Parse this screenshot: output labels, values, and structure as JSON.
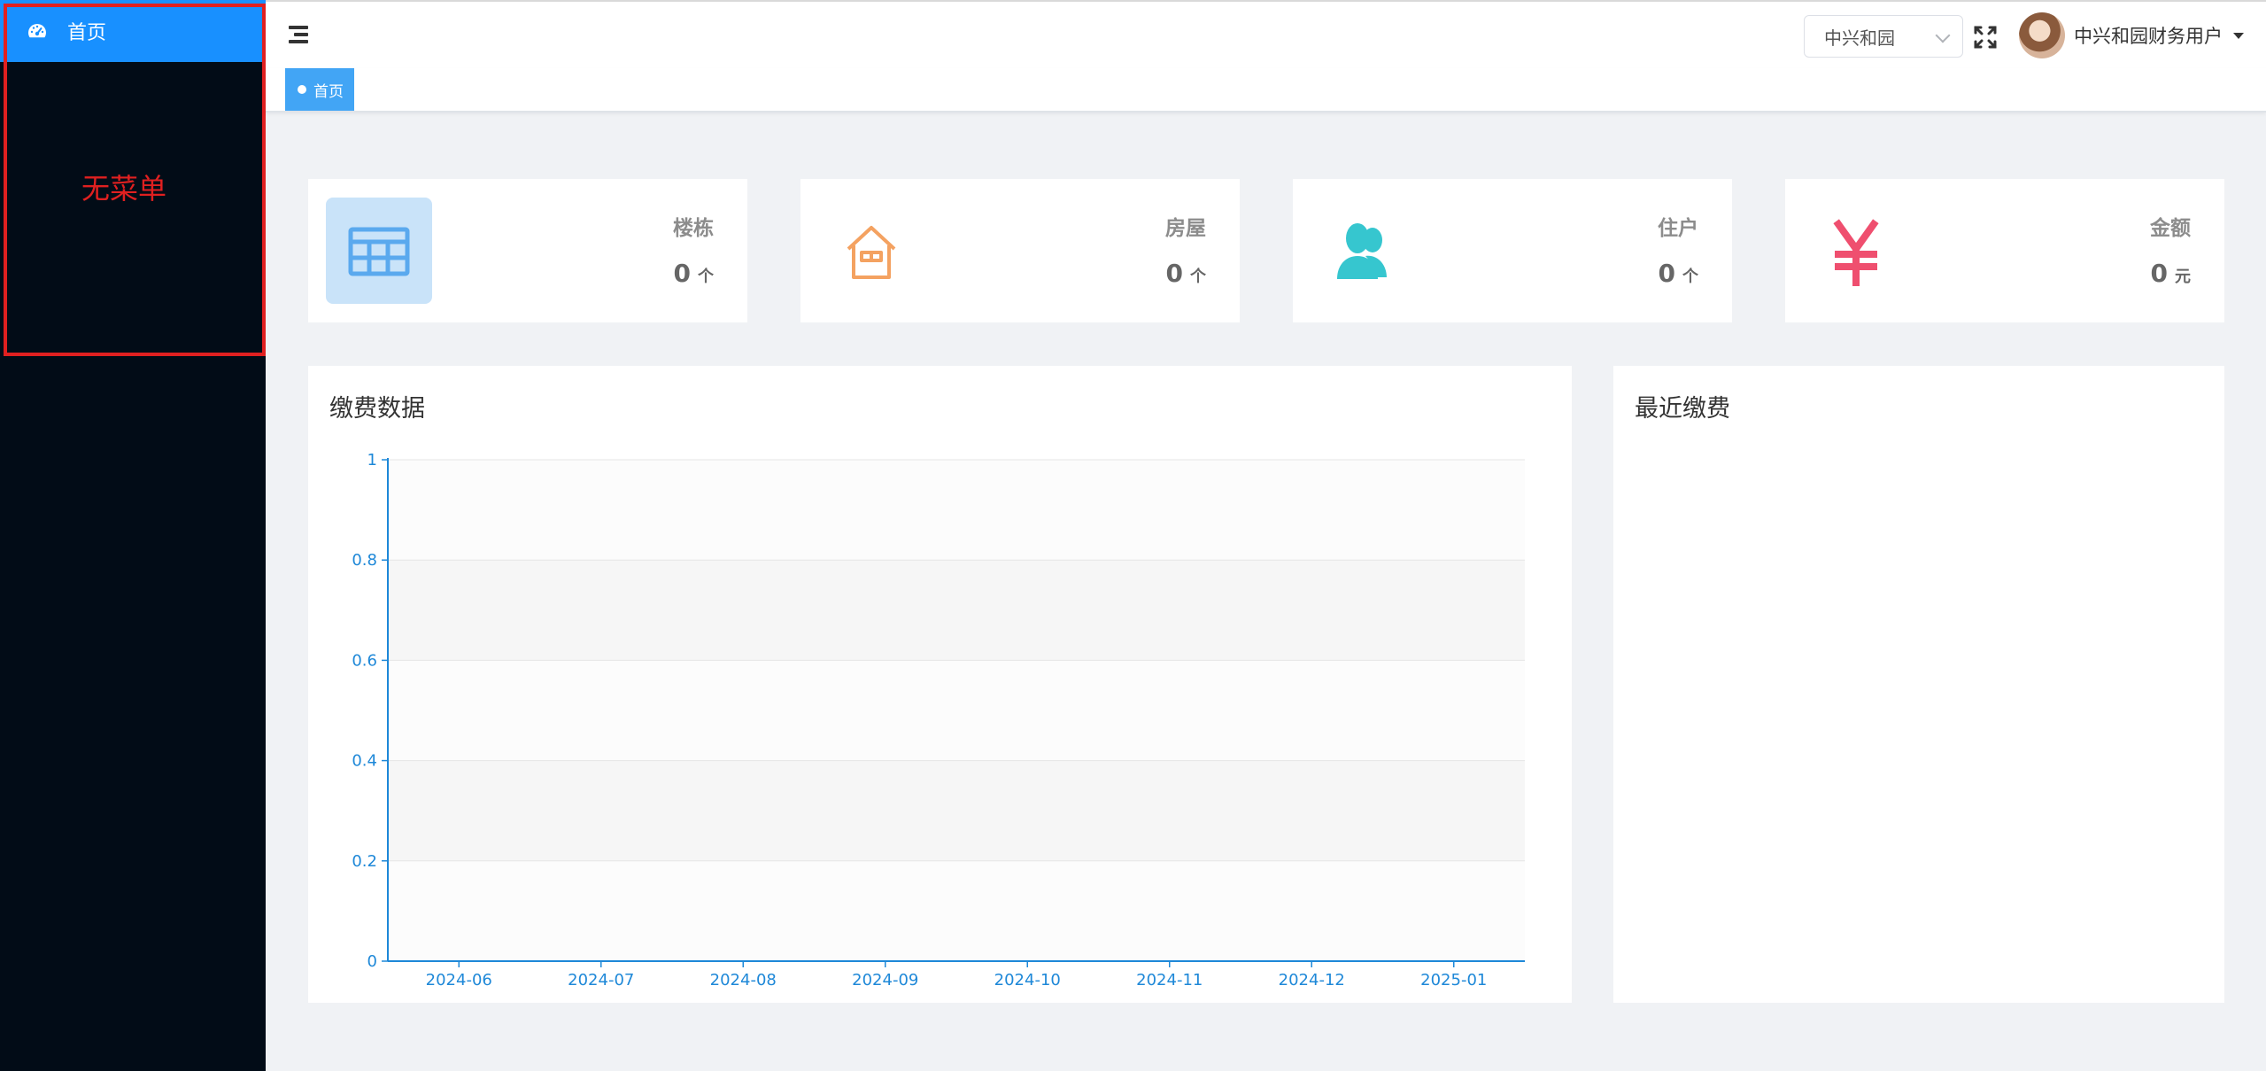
{
  "sidebar": {
    "home_label": "首页",
    "annotation": "无菜单",
    "accent": "#1890ff",
    "annotation_color": "#e02020"
  },
  "navbar": {
    "menu_icon": "hamburger-icon",
    "community_selected": "中兴和园",
    "fullscreen_icon": "fullscreen-icon",
    "user_name": "中兴和园财务用户"
  },
  "tags": {
    "home_label": "首页"
  },
  "stats": [
    {
      "icon": "building-grid-icon",
      "label": "楼栋",
      "value": "0",
      "unit": "个",
      "color": "#5aa9ee"
    },
    {
      "icon": "house-icon",
      "label": "房屋",
      "value": "0",
      "unit": "个",
      "color": "#f4a261"
    },
    {
      "icon": "residents-icon",
      "label": "住户",
      "value": "0",
      "unit": "个",
      "color": "#36c6cf"
    },
    {
      "icon": "yuan-icon",
      "label": "金额",
      "value": "0",
      "unit": "元",
      "color": "#ef4f6f"
    }
  ],
  "payment_panel": {
    "title": "缴费数据"
  },
  "recent_panel": {
    "title": "最近缴费"
  },
  "chart_data": {
    "type": "line",
    "title": "",
    "xlabel": "",
    "ylabel": "",
    "categories": [
      "2024-06",
      "2024-07",
      "2024-08",
      "2024-09",
      "2024-10",
      "2024-11",
      "2024-12",
      "2025-01"
    ],
    "series": [],
    "ylim": [
      0,
      1
    ],
    "yticks": [
      "0",
      "0.2",
      "0.4",
      "0.6",
      "0.8",
      "1"
    ],
    "grid": true,
    "axis_color": "#1e88d8",
    "band_colors": [
      "#fcfcfc",
      "#f6f6f6"
    ]
  }
}
